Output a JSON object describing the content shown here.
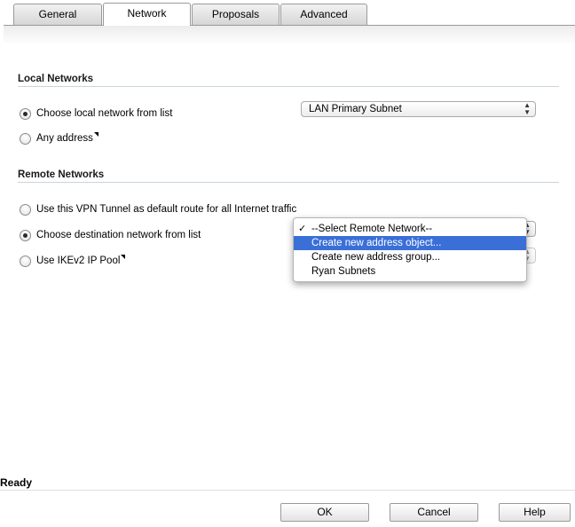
{
  "tabs": [
    {
      "label": "General"
    },
    {
      "label": "Network",
      "active": true
    },
    {
      "label": "Proposals"
    },
    {
      "label": "Advanced"
    }
  ],
  "local_networks": {
    "title": "Local Networks",
    "options": [
      {
        "label": "Choose local network from list",
        "checked": true
      },
      {
        "label": "Any address",
        "checked": false
      }
    ],
    "select_value": "LAN Primary Subnet"
  },
  "remote_networks": {
    "title": "Remote Networks",
    "options": [
      {
        "label": "Use this VPN Tunnel as default route for all Internet traffic",
        "checked": false
      },
      {
        "label": "Choose destination network from list",
        "checked": true
      },
      {
        "label": "Use IKEv2 IP Pool",
        "checked": false
      }
    ],
    "dropdown": {
      "items": [
        {
          "label": "--Select Remote Network--",
          "checked": true
        },
        {
          "label": "Create new address object...",
          "highlighted": true
        },
        {
          "label": "Create new address group..."
        },
        {
          "label": "Ryan Subnets"
        }
      ]
    }
  },
  "status": "Ready",
  "buttons": {
    "ok": "OK",
    "cancel": "Cancel",
    "help": "Help"
  },
  "colors": {
    "highlight": "#3a6fd8"
  }
}
